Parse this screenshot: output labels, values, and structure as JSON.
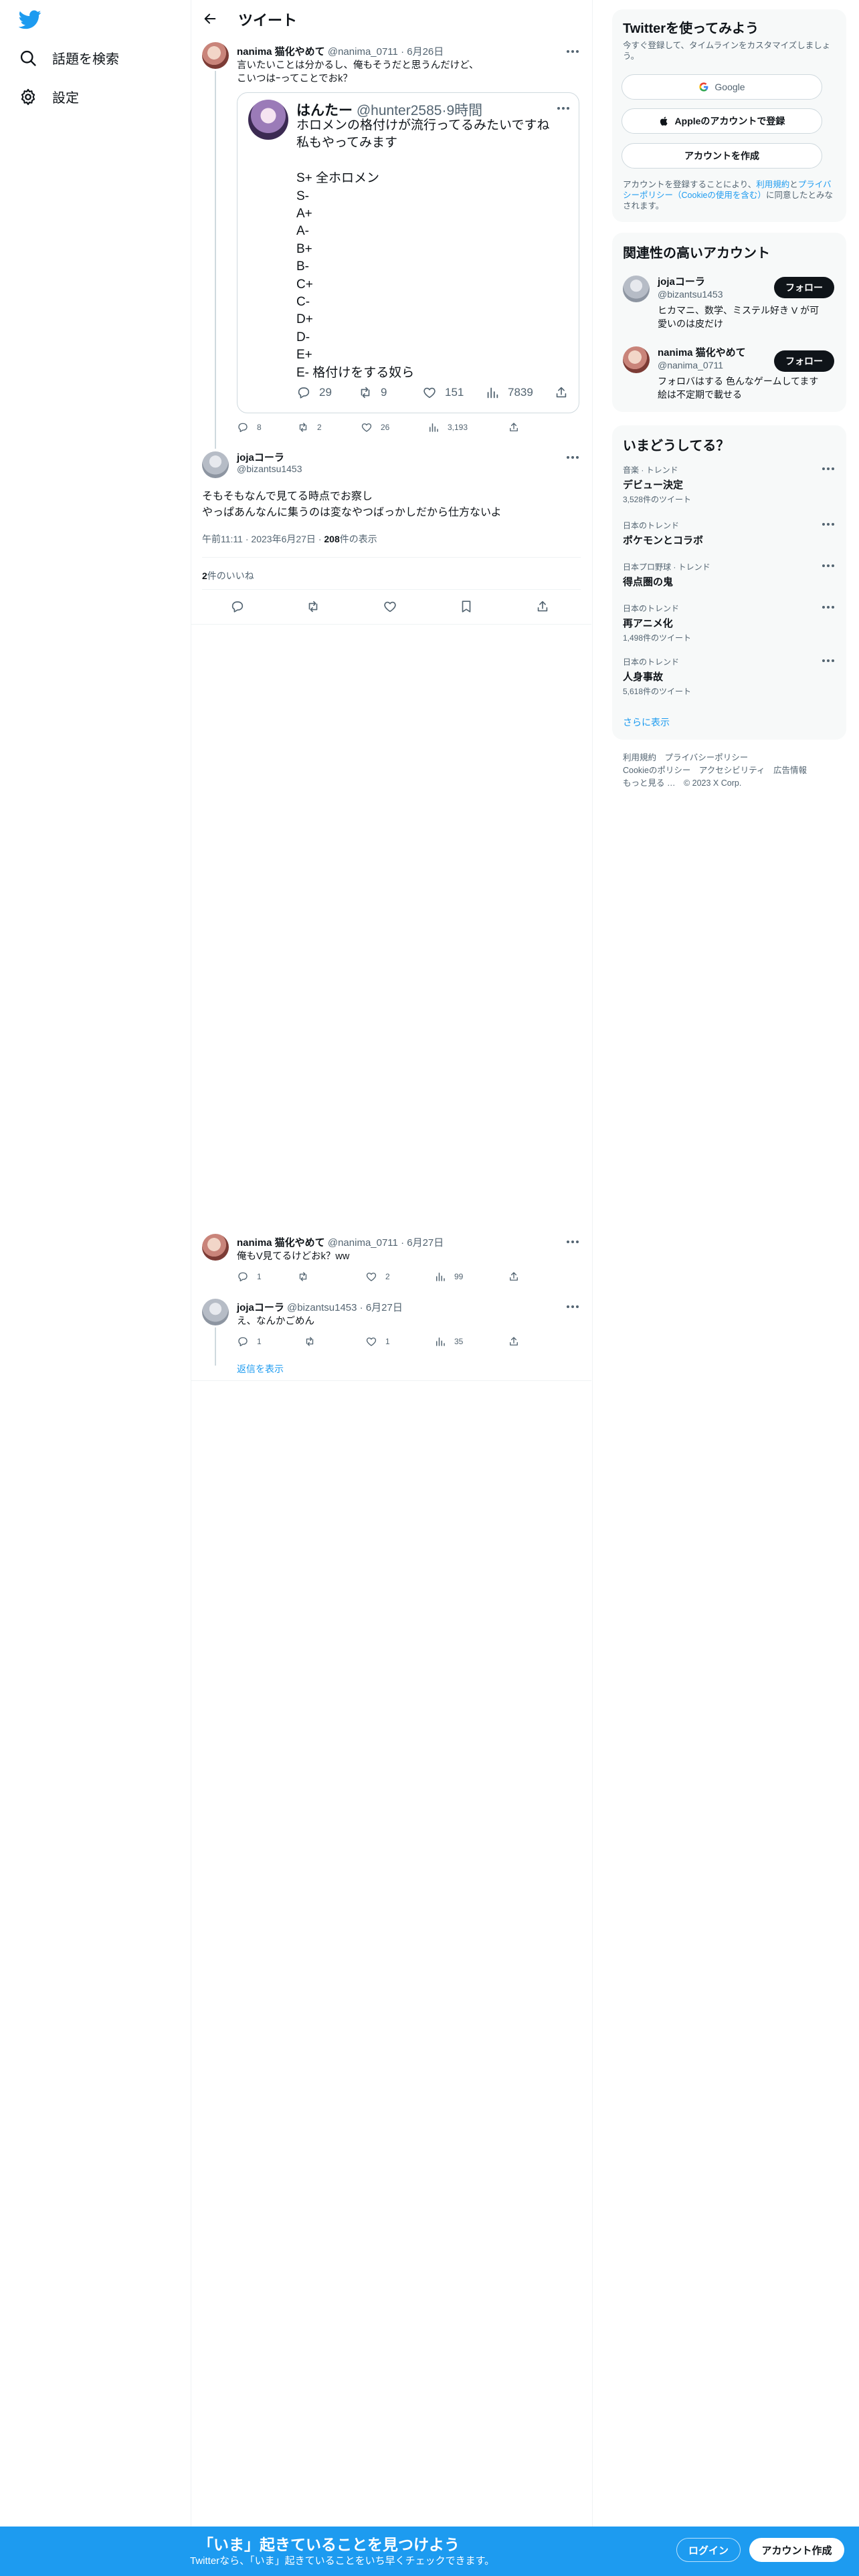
{
  "nav": {
    "explore_label": "話題を検索",
    "settings_label": "設定"
  },
  "header": {
    "title": "ツイート"
  },
  "parent_tweet": {
    "name": "nanima 猫化やめて",
    "handle": "@nanima_0711",
    "sep": "·",
    "date": "6月26日",
    "text": "言いたいことは分かるし、俺もそうだと思うんだけど、\nこいつはｰってことでおk？",
    "quote": {
      "name": "はんたー",
      "handle": "@hunter2585",
      "sep": "·",
      "time": "9時間",
      "text": "ホロメンの格付けが流行ってるみたいですね\n私もやってみます\n\nS+ 全ホロメン\nS-\nA+\nA-\nB+\nB-\nC+\nC-\nD+\nD-\nE+\nE- 格付けをする奴ら",
      "replies": "29",
      "retweets": "9",
      "likes": "151",
      "views": "7839"
    },
    "replies": "8",
    "retweets": "2",
    "likes": "26",
    "views": "3,193"
  },
  "main_tweet": {
    "name": "jojaコーラ",
    "handle": "@bizantsu1453",
    "text": "そもそもなんで見てる時点でお察し\nやっぱあんなんに集うのは変なやつばっかしだから仕方ないよ",
    "time": "午前11:11",
    "sep": "·",
    "date": "2023年6月27日",
    "views_count": "208",
    "views_label": "件の表示",
    "likes_count": "2",
    "likes_label": "件のいいね"
  },
  "replies": [
    {
      "name": "nanima 猫化やめて",
      "handle": "@nanima_0711",
      "sep": "·",
      "date": "6月27日",
      "text": "俺もV見てるけどおk？ww",
      "replies": "1",
      "retweets": "",
      "likes": "2",
      "views": "99"
    },
    {
      "name": "jojaコーラ",
      "handle": "@bizantsu1453",
      "sep": "·",
      "date": "6月27日",
      "text": "え、なんかごめん",
      "replies": "1",
      "retweets": "",
      "likes": "1",
      "views": "35"
    }
  ],
  "show_replies": "返信を表示",
  "signup_box": {
    "title": "Twitterを使ってみよう",
    "subtitle": "今すぐ登録して、タイムラインをカスタマイズしましょう。",
    "google_label": "Google",
    "apple_label": "Appleのアカウントで登録",
    "create_label": "アカウントを作成",
    "terms_prefix": "アカウントを登録することにより、",
    "terms_link": "利用規約",
    "terms_and": "と",
    "privacy_link": "プライバシーポリシー",
    "cookie_link": "（Cookieの使用を含む）",
    "terms_suffix": "に同意したとみなされます。"
  },
  "relevant": {
    "title": "関連性の高いアカウント",
    "follow_label": "フォロー",
    "accounts": [
      {
        "name": "jojaコーラ",
        "handle": "@bizantsu1453",
        "bio": "ヒカマニ、数学、ミステル好き V が可\n愛いのは皮だけ"
      },
      {
        "name": "nanima 猫化やめて",
        "handle": "@nanima_0711",
        "bio": "フォロバはする 色んなゲームしてます\n絵は不定期で載せる"
      }
    ]
  },
  "trends": {
    "title": "いまどうしてる？",
    "items": [
      {
        "cat": "音楽 · トレンド",
        "title": "デビュー決定",
        "count": "3,528件のツイート"
      },
      {
        "cat": "日本のトレンド",
        "title": "ポケモンとコラボ",
        "count": ""
      },
      {
        "cat": "日本プロ野球 · トレンド",
        "title": "得点圏の鬼",
        "count": ""
      },
      {
        "cat": "日本のトレンド",
        "title": "再アニメ化",
        "count": "1,498件のツイート"
      },
      {
        "cat": "日本のトレンド",
        "title": "人身事故",
        "count": "5,618件のツイート"
      }
    ],
    "more": "さらに表示"
  },
  "footer": {
    "line1": "利用規約　プライバシーポリシー",
    "line2": "Cookieのポリシー　アクセシビリティ　広告情報",
    "line3": "もっと見る …　© 2023 X Corp."
  },
  "bottom_bar": {
    "headline": "「いま」起きていることを見つけよう",
    "sub": "Twitterなら、「いま」起きていることをいち早くチェックできます。",
    "login": "ログイン",
    "signup": "アカウント作成"
  },
  "colors": {
    "brand": "#1d9bf0",
    "text": "#0f1419",
    "muted": "#536471"
  }
}
